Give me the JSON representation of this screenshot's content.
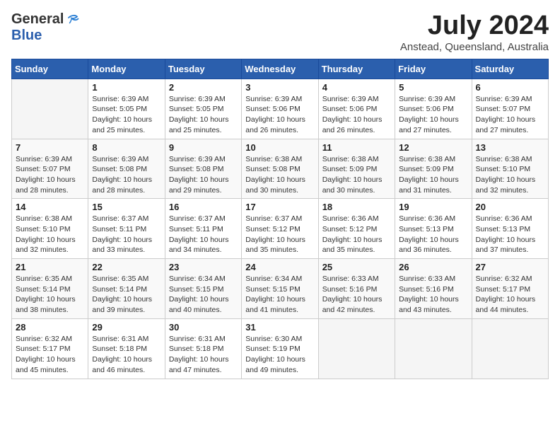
{
  "header": {
    "logo_general": "General",
    "logo_blue": "Blue",
    "month": "July 2024",
    "location": "Anstead, Queensland, Australia"
  },
  "days_of_week": [
    "Sunday",
    "Monday",
    "Tuesday",
    "Wednesday",
    "Thursday",
    "Friday",
    "Saturday"
  ],
  "weeks": [
    [
      {
        "day": "",
        "info": ""
      },
      {
        "day": "1",
        "info": "Sunrise: 6:39 AM\nSunset: 5:05 PM\nDaylight: 10 hours\nand 25 minutes."
      },
      {
        "day": "2",
        "info": "Sunrise: 6:39 AM\nSunset: 5:05 PM\nDaylight: 10 hours\nand 25 minutes."
      },
      {
        "day": "3",
        "info": "Sunrise: 6:39 AM\nSunset: 5:06 PM\nDaylight: 10 hours\nand 26 minutes."
      },
      {
        "day": "4",
        "info": "Sunrise: 6:39 AM\nSunset: 5:06 PM\nDaylight: 10 hours\nand 26 minutes."
      },
      {
        "day": "5",
        "info": "Sunrise: 6:39 AM\nSunset: 5:06 PM\nDaylight: 10 hours\nand 27 minutes."
      },
      {
        "day": "6",
        "info": "Sunrise: 6:39 AM\nSunset: 5:07 PM\nDaylight: 10 hours\nand 27 minutes."
      }
    ],
    [
      {
        "day": "7",
        "info": "Sunrise: 6:39 AM\nSunset: 5:07 PM\nDaylight: 10 hours\nand 28 minutes."
      },
      {
        "day": "8",
        "info": "Sunrise: 6:39 AM\nSunset: 5:08 PM\nDaylight: 10 hours\nand 28 minutes."
      },
      {
        "day": "9",
        "info": "Sunrise: 6:39 AM\nSunset: 5:08 PM\nDaylight: 10 hours\nand 29 minutes."
      },
      {
        "day": "10",
        "info": "Sunrise: 6:38 AM\nSunset: 5:08 PM\nDaylight: 10 hours\nand 30 minutes."
      },
      {
        "day": "11",
        "info": "Sunrise: 6:38 AM\nSunset: 5:09 PM\nDaylight: 10 hours\nand 30 minutes."
      },
      {
        "day": "12",
        "info": "Sunrise: 6:38 AM\nSunset: 5:09 PM\nDaylight: 10 hours\nand 31 minutes."
      },
      {
        "day": "13",
        "info": "Sunrise: 6:38 AM\nSunset: 5:10 PM\nDaylight: 10 hours\nand 32 minutes."
      }
    ],
    [
      {
        "day": "14",
        "info": "Sunrise: 6:38 AM\nSunset: 5:10 PM\nDaylight: 10 hours\nand 32 minutes."
      },
      {
        "day": "15",
        "info": "Sunrise: 6:37 AM\nSunset: 5:11 PM\nDaylight: 10 hours\nand 33 minutes."
      },
      {
        "day": "16",
        "info": "Sunrise: 6:37 AM\nSunset: 5:11 PM\nDaylight: 10 hours\nand 34 minutes."
      },
      {
        "day": "17",
        "info": "Sunrise: 6:37 AM\nSunset: 5:12 PM\nDaylight: 10 hours\nand 35 minutes."
      },
      {
        "day": "18",
        "info": "Sunrise: 6:36 AM\nSunset: 5:12 PM\nDaylight: 10 hours\nand 35 minutes."
      },
      {
        "day": "19",
        "info": "Sunrise: 6:36 AM\nSunset: 5:13 PM\nDaylight: 10 hours\nand 36 minutes."
      },
      {
        "day": "20",
        "info": "Sunrise: 6:36 AM\nSunset: 5:13 PM\nDaylight: 10 hours\nand 37 minutes."
      }
    ],
    [
      {
        "day": "21",
        "info": "Sunrise: 6:35 AM\nSunset: 5:14 PM\nDaylight: 10 hours\nand 38 minutes."
      },
      {
        "day": "22",
        "info": "Sunrise: 6:35 AM\nSunset: 5:14 PM\nDaylight: 10 hours\nand 39 minutes."
      },
      {
        "day": "23",
        "info": "Sunrise: 6:34 AM\nSunset: 5:15 PM\nDaylight: 10 hours\nand 40 minutes."
      },
      {
        "day": "24",
        "info": "Sunrise: 6:34 AM\nSunset: 5:15 PM\nDaylight: 10 hours\nand 41 minutes."
      },
      {
        "day": "25",
        "info": "Sunrise: 6:33 AM\nSunset: 5:16 PM\nDaylight: 10 hours\nand 42 minutes."
      },
      {
        "day": "26",
        "info": "Sunrise: 6:33 AM\nSunset: 5:16 PM\nDaylight: 10 hours\nand 43 minutes."
      },
      {
        "day": "27",
        "info": "Sunrise: 6:32 AM\nSunset: 5:17 PM\nDaylight: 10 hours\nand 44 minutes."
      }
    ],
    [
      {
        "day": "28",
        "info": "Sunrise: 6:32 AM\nSunset: 5:17 PM\nDaylight: 10 hours\nand 45 minutes."
      },
      {
        "day": "29",
        "info": "Sunrise: 6:31 AM\nSunset: 5:18 PM\nDaylight: 10 hours\nand 46 minutes."
      },
      {
        "day": "30",
        "info": "Sunrise: 6:31 AM\nSunset: 5:18 PM\nDaylight: 10 hours\nand 47 minutes."
      },
      {
        "day": "31",
        "info": "Sunrise: 6:30 AM\nSunset: 5:19 PM\nDaylight: 10 hours\nand 49 minutes."
      },
      {
        "day": "",
        "info": ""
      },
      {
        "day": "",
        "info": ""
      },
      {
        "day": "",
        "info": ""
      }
    ]
  ]
}
